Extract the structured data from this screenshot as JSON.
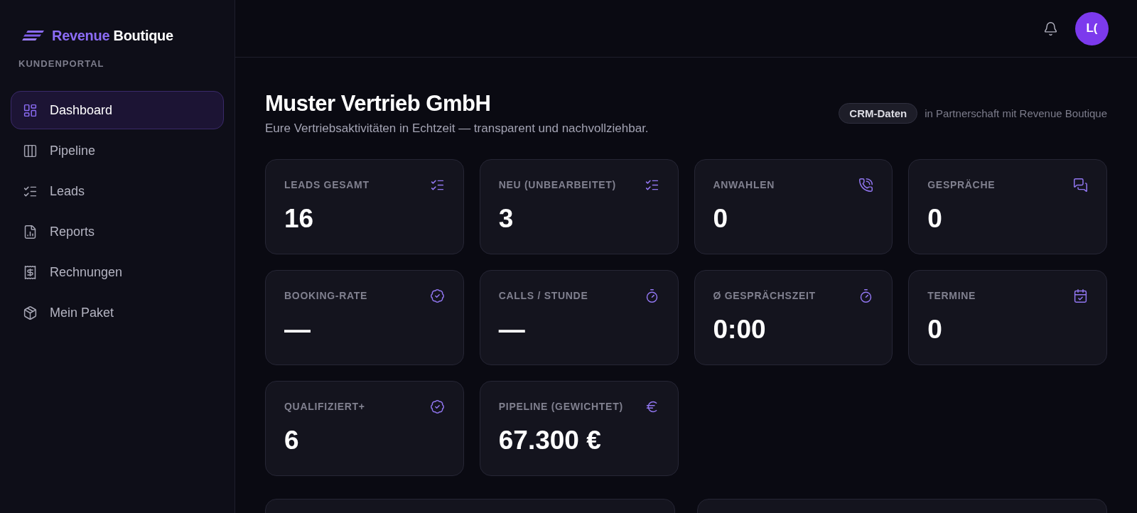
{
  "brand": {
    "highlight": "Revenue",
    "name": "Boutique",
    "section_label": "KUNDENPORTAL"
  },
  "sidebar": {
    "items": [
      {
        "label": "Dashboard",
        "selected": true
      },
      {
        "label": "Pipeline",
        "selected": false
      },
      {
        "label": "Leads",
        "selected": false
      },
      {
        "label": "Reports",
        "selected": false
      },
      {
        "label": "Rechnungen",
        "selected": false
      },
      {
        "label": "Mein Paket",
        "selected": false
      }
    ]
  },
  "header": {
    "user": {
      "initials": "L("
    }
  },
  "page": {
    "title": "Muster Vertrieb GmbH",
    "subtitle": "Eure Vertriebsaktivitäten in Echtzeit — transparent und nachvollziehbar.",
    "source_badge": "CRM-Daten",
    "partner_note": "in Partnerschaft mit Revenue Boutique"
  },
  "metrics": [
    {
      "label": "LEADS GESAMT",
      "value": "16"
    },
    {
      "label": "NEU (UNBEARBEITET)",
      "value": "3"
    },
    {
      "label": "ANWAHLEN",
      "value": "0"
    },
    {
      "label": "GESPRÄCHE",
      "value": "0"
    },
    {
      "label": "BOOKING-RATE",
      "value": "—"
    },
    {
      "label": "CALLS / STUNDE",
      "value": "—"
    },
    {
      "label": "Ø GESPRÄCHSZEIT",
      "value": "0:00"
    },
    {
      "label": "TERMINE",
      "value": "0"
    },
    {
      "label": "QUALIFIZIERT+",
      "value": "6"
    },
    {
      "label": "PIPELINE (GEWICHTET)",
      "value": "67.300 €"
    }
  ]
}
